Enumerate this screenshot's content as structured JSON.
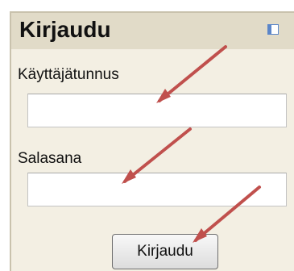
{
  "login_block": {
    "title": "Kirjaudu",
    "username_label": "Käyttäjätunnus",
    "username_value": "",
    "password_label": "Salasana",
    "password_value": "",
    "submit_label": "Kirjaudu"
  },
  "annotation": {
    "arrow_color": "#c0504d",
    "count": 3
  },
  "colors": {
    "block_background": "#f3efe3",
    "header_background": "#e1dbc8"
  }
}
